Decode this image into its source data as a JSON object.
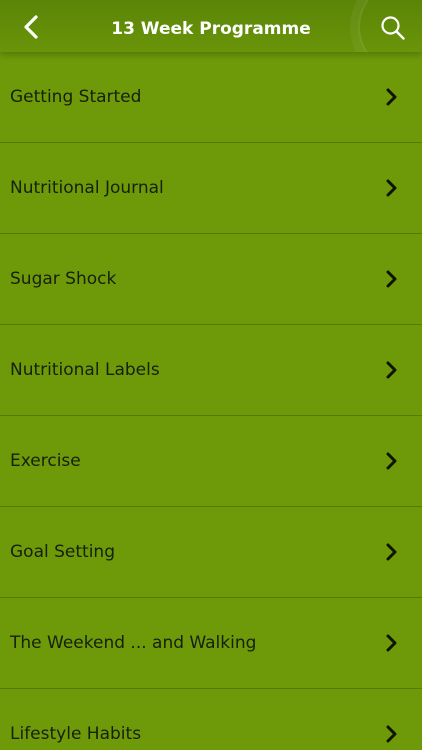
{
  "header": {
    "title": "13 Week Programme",
    "back_icon": "chevron-left-icon",
    "search_icon": "search-icon"
  },
  "colors": {
    "background": "#6e9a0a",
    "header": "#5a8507",
    "separator": "#557a06",
    "text": "#16200a"
  },
  "list": {
    "items": [
      {
        "label": "Getting Started"
      },
      {
        "label": "Nutritional Journal"
      },
      {
        "label": "Sugar Shock"
      },
      {
        "label": "Nutritional Labels"
      },
      {
        "label": "Exercise"
      },
      {
        "label": "Goal Setting"
      },
      {
        "label": "The Weekend ... and Walking"
      },
      {
        "label": "Lifestyle Habits"
      }
    ]
  }
}
